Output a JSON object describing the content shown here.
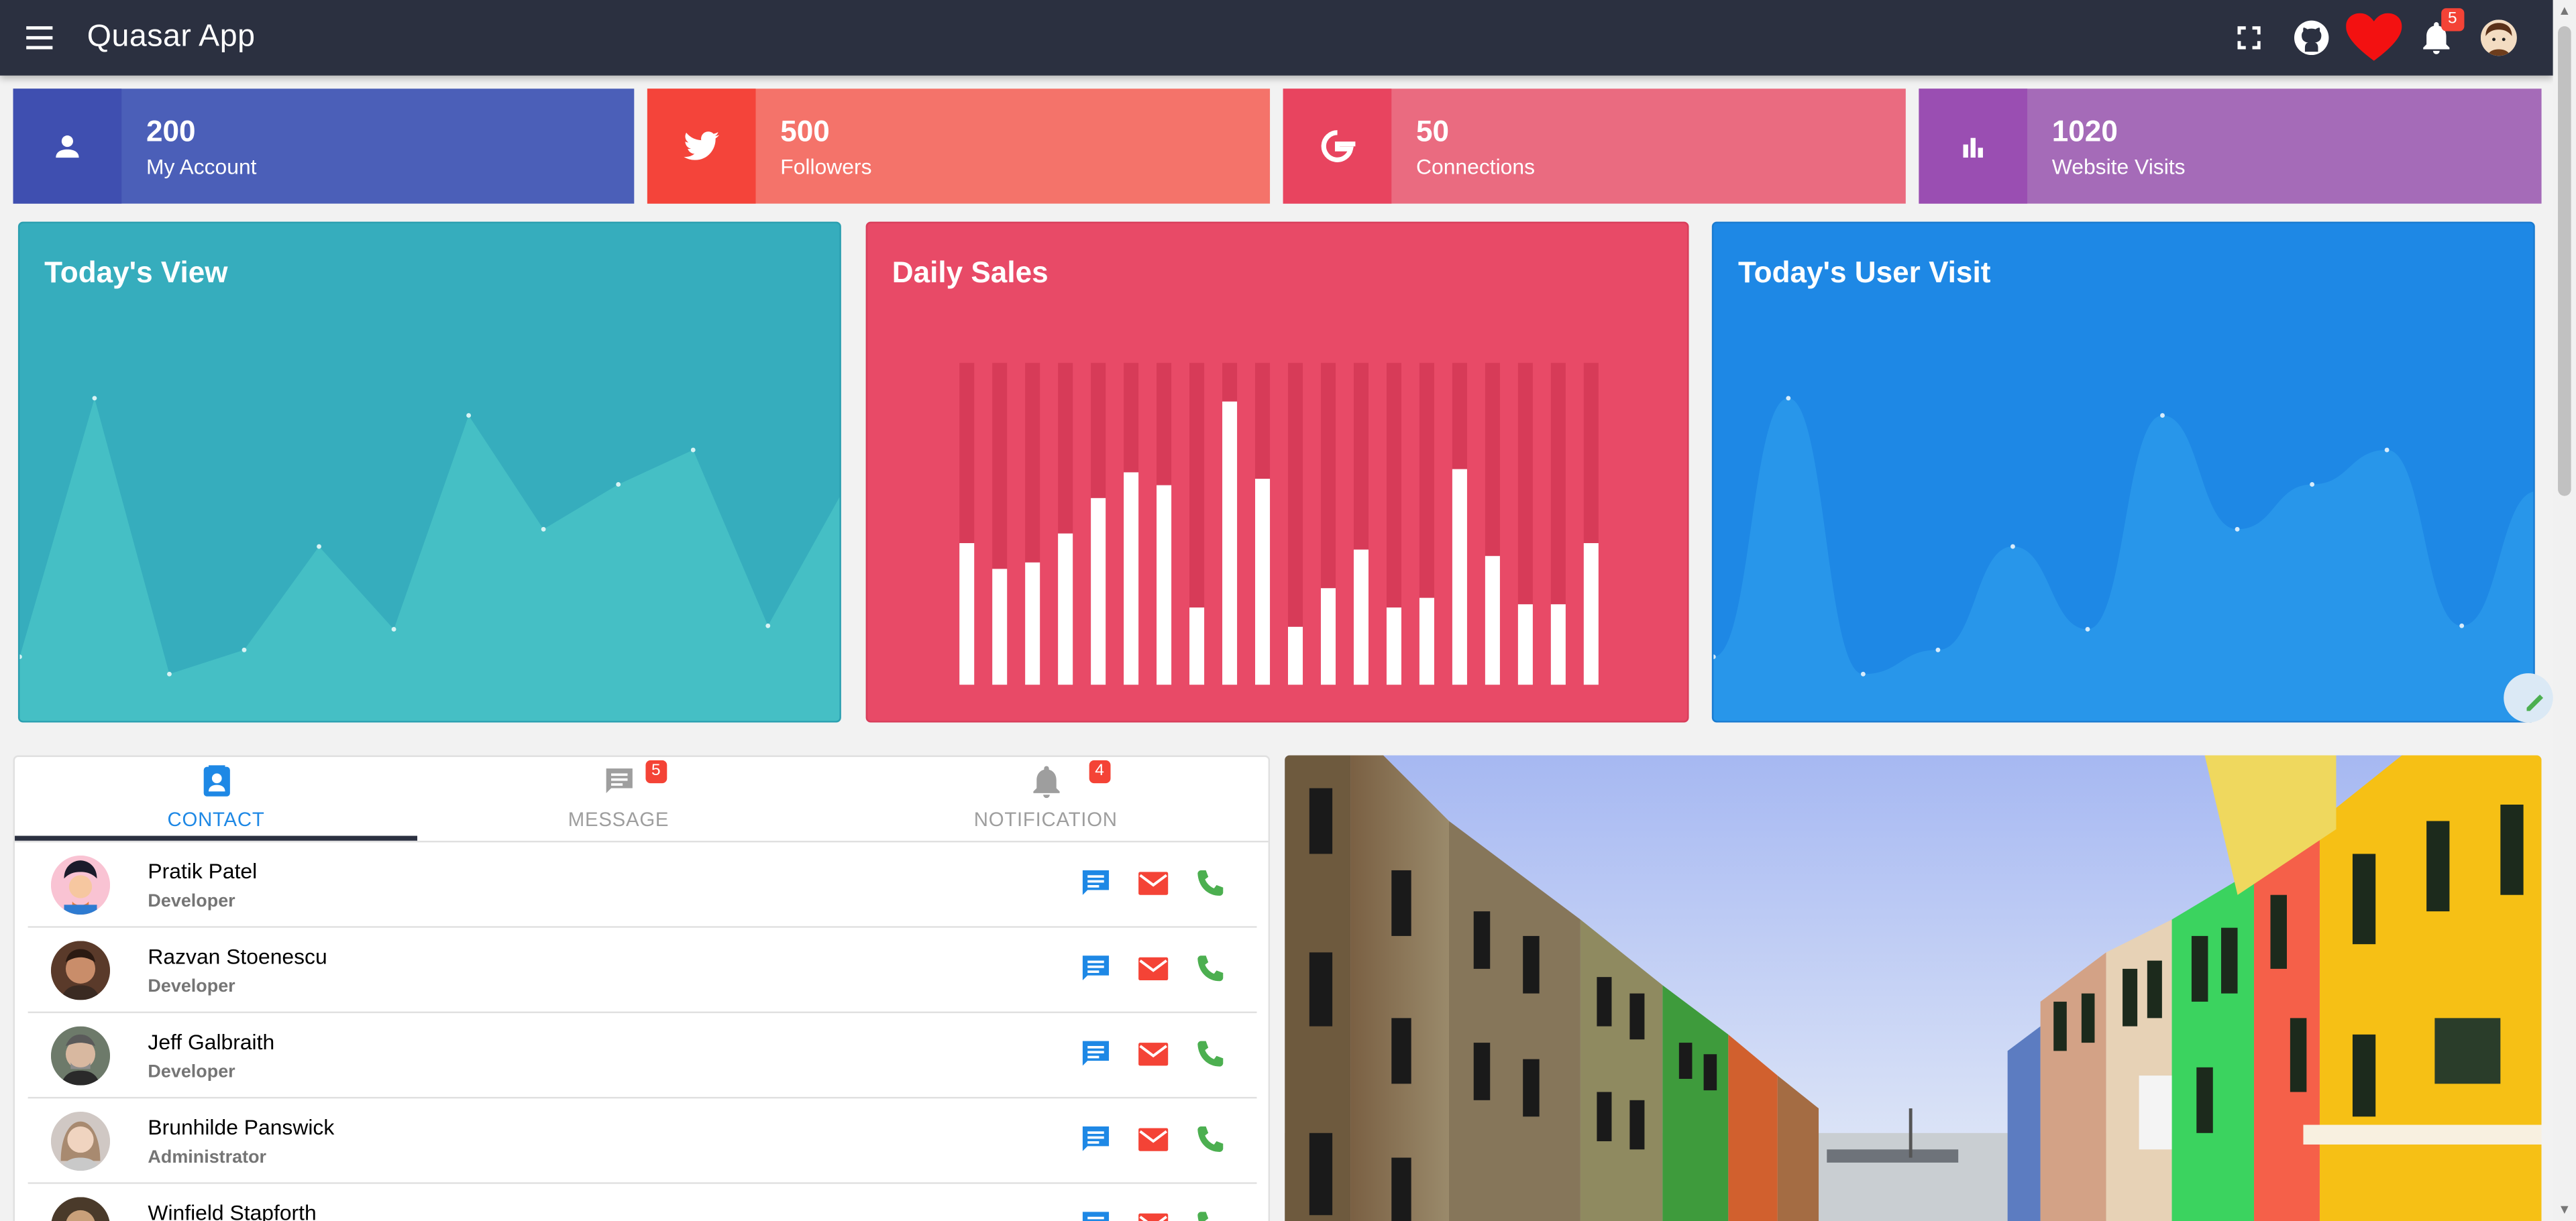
{
  "app": {
    "title": "Quasar App"
  },
  "header": {
    "notification_count": "5"
  },
  "stats": [
    {
      "value": "200",
      "label": "My Account",
      "icon": "person-icon",
      "color": "#4b5fb8"
    },
    {
      "value": "500",
      "label": "Followers",
      "icon": "twitter-icon",
      "color": "#f4736a"
    },
    {
      "value": "50",
      "label": "Connections",
      "icon": "google-icon",
      "color": "#ea6b80"
    },
    {
      "value": "1020",
      "label": "Website Visits",
      "icon": "bar-chart-icon",
      "color": "#a56bb8"
    }
  ],
  "cards": {
    "todays_view": {
      "title": "Today's View",
      "color": "#36adbd"
    },
    "daily_sales": {
      "title": "Daily Sales",
      "color": "#e84a67"
    },
    "user_visit": {
      "title": "Today's User Visit",
      "color": "#1e88e5"
    }
  },
  "chart_data": [
    {
      "type": "area",
      "title": "Today's View",
      "x": [
        0,
        1,
        2,
        3,
        4,
        5,
        6,
        7,
        8,
        9,
        10,
        11
      ],
      "values": [
        10,
        85,
        5,
        12,
        42,
        18,
        80,
        47,
        60,
        70,
        19,
        58
      ],
      "ylim": [
        0,
        100
      ]
    },
    {
      "type": "bar",
      "title": "Daily Sales",
      "values": [
        44,
        36,
        38,
        47,
        58,
        66,
        62,
        24,
        88,
        64,
        18,
        30,
        42,
        24,
        27,
        67,
        40,
        25,
        25,
        44
      ],
      "ylim": [
        0,
        100
      ]
    },
    {
      "type": "area",
      "title": "Today's User Visit",
      "x": [
        0,
        1,
        2,
        3,
        4,
        5,
        6,
        7,
        8,
        9,
        10,
        11
      ],
      "values": [
        10,
        85,
        5,
        12,
        42,
        18,
        80,
        47,
        60,
        70,
        19,
        58
      ],
      "ylim": [
        0,
        100
      ]
    }
  ],
  "tabs": [
    {
      "label": "CONTACT",
      "badge": ""
    },
    {
      "label": "MESSAGE",
      "badge": "5"
    },
    {
      "label": "NOTIFICATION",
      "badge": "4"
    }
  ],
  "contacts": [
    {
      "name": "Pratik Patel",
      "role": "Developer"
    },
    {
      "name": "Razvan Stoenescu",
      "role": "Developer"
    },
    {
      "name": "Jeff Galbraith",
      "role": "Developer"
    },
    {
      "name": "Brunhilde Panswick",
      "role": "Administrator"
    },
    {
      "name": "Winfield Stapforth",
      "role": ""
    }
  ]
}
